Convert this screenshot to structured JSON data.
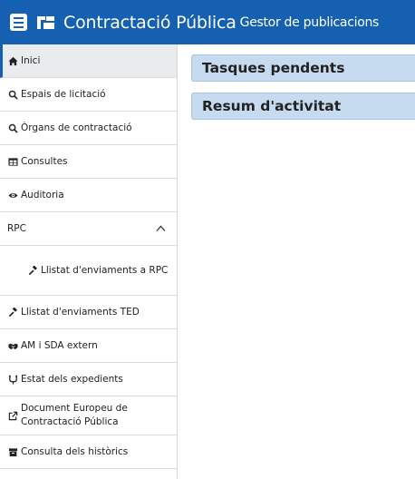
{
  "header": {
    "app_name": "Contractació Pública",
    "subtitle": "Gestor de publicacions",
    "bg_color": "#1660b2"
  },
  "sidebar": {
    "items": [
      {
        "label": "Inici",
        "icon": "home-icon",
        "active": true
      },
      {
        "label": "Espais de licitació",
        "icon": "search-icon"
      },
      {
        "label": "Òrgans de contractació",
        "icon": "search-icon"
      },
      {
        "label": "Consultes",
        "icon": "table-icon"
      },
      {
        "label": "Auditoria",
        "icon": "eye-icon"
      },
      {
        "label": "RPC",
        "icon": "chevron-up-icon",
        "expanded": true
      },
      {
        "label": "Llistat d'enviaments a RPC",
        "icon": "gavel-icon",
        "submenu": true
      },
      {
        "label": "Llistat d'enviaments TED",
        "icon": "gavel-icon"
      },
      {
        "label": "AM i SDA extern",
        "icon": "handshake-icon"
      },
      {
        "label": "Estat dels expedients",
        "icon": "tree-icon"
      },
      {
        "label": "Document Europeu de Contractació Pública",
        "icon": "external-link-icon"
      },
      {
        "label": "Consulta dels històrics",
        "icon": "archive-icon"
      }
    ]
  },
  "main": {
    "panels": [
      {
        "title": "Tasques pendents"
      },
      {
        "title": "Resum d'activitat"
      }
    ]
  },
  "colors": {
    "accent": "#1660b2",
    "panel_bg": "#c6daf0",
    "active_item_bg": "#e9ecef"
  }
}
